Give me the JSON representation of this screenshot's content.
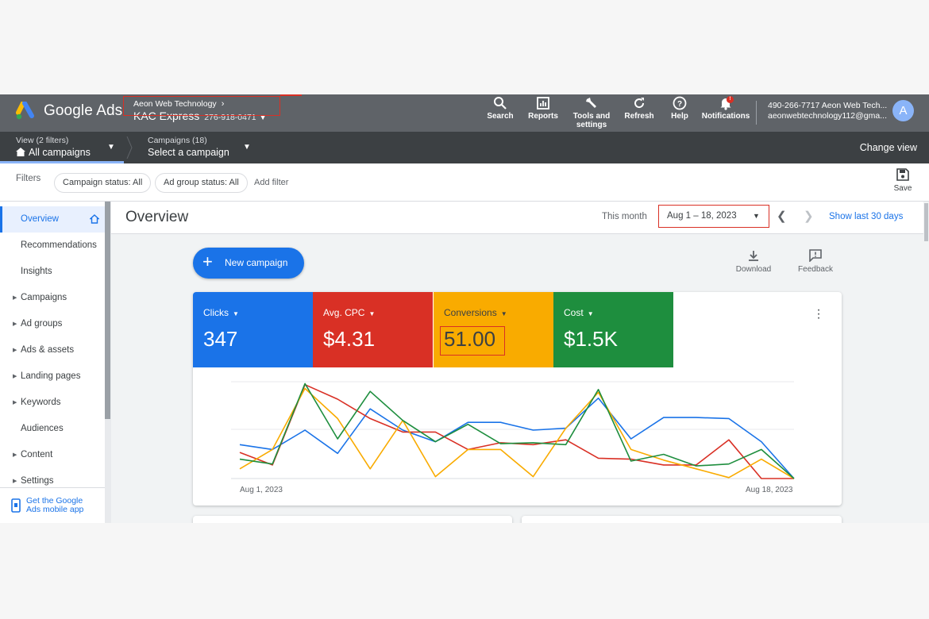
{
  "topbar": {
    "brand": "Google Ads",
    "account_parent": "Aeon Web Technology",
    "account_name": "KAC Express",
    "account_id": "276-918-0471",
    "buttons": [
      {
        "label": "Search",
        "icon": "search-icon"
      },
      {
        "label": "Reports",
        "icon": "reports-icon"
      },
      {
        "label": "Tools and settings",
        "icon": "wrench-icon"
      },
      {
        "label": "Refresh",
        "icon": "refresh-icon"
      },
      {
        "label": "Help",
        "icon": "help-icon"
      },
      {
        "label": "Notifications",
        "icon": "bell-icon",
        "badge": "!"
      }
    ],
    "user_phone": "490-266-7717 Aeon Web Tech...",
    "user_email": "aeonwebtechnology112@gma...",
    "avatar_initial": "A"
  },
  "viewbar": {
    "view_small": "View (2 filters)",
    "view_big": "All campaigns",
    "campaigns_small": "Campaigns (18)",
    "campaigns_big": "Select a campaign",
    "change_view": "Change view"
  },
  "filterbar": {
    "label": "Filters",
    "chips": [
      "Campaign status: All",
      "Ad group status: All"
    ],
    "add_filter": "Add filter",
    "save": "Save"
  },
  "sidebar": {
    "items": [
      {
        "label": "Overview",
        "active": true,
        "expandable": false
      },
      {
        "label": "Recommendations",
        "expandable": false
      },
      {
        "label": "Insights",
        "expandable": false
      },
      {
        "label": "Campaigns",
        "expandable": true
      },
      {
        "label": "Ad groups",
        "expandable": true
      },
      {
        "label": "Ads & assets",
        "expandable": true
      },
      {
        "label": "Landing pages",
        "expandable": true
      },
      {
        "label": "Keywords",
        "expandable": true
      },
      {
        "label": "Audiences",
        "expandable": false
      },
      {
        "label": "Content",
        "expandable": true
      },
      {
        "label": "Settings",
        "expandable": true
      }
    ],
    "app_promo_line1": "Get the Google",
    "app_promo_line2": "Ads mobile app"
  },
  "main": {
    "title": "Overview",
    "this_month": "This month",
    "date_range": "Aug 1 – 18, 2023",
    "show_last": "Show last 30 days",
    "new_campaign": "New campaign",
    "download": "Download",
    "feedback": "Feedback"
  },
  "metrics": [
    {
      "name": "Clicks",
      "value": "347",
      "color": "#1a73e8"
    },
    {
      "name": "Avg. CPC",
      "value": "$4.31",
      "color": "#d93025"
    },
    {
      "name": "Conversions",
      "value": "51.00",
      "color": "#f9ab00"
    },
    {
      "name": "Cost",
      "value": "$1.5K",
      "color": "#1e8e3e"
    }
  ],
  "chart_data": {
    "type": "line",
    "x_start_label": "Aug 1, 2023",
    "x_end_label": "Aug 18, 2023",
    "grid": true,
    "note": "normalized 0-1 scale relative to each series",
    "series": [
      {
        "name": "Clicks",
        "color": "#1a73e8",
        "values": [
          0.35,
          0.3,
          0.5,
          0.26,
          0.72,
          0.5,
          0.38,
          0.58,
          0.58,
          0.5,
          0.52,
          0.83,
          0.41,
          0.63,
          0.63,
          0.62,
          0.38,
          0.0
        ]
      },
      {
        "name": "Avg. CPC",
        "color": "#d93025",
        "values": [
          0.27,
          0.14,
          0.97,
          0.82,
          0.62,
          0.48,
          0.48,
          0.3,
          0.37,
          0.35,
          0.4,
          0.21,
          0.2,
          0.14,
          0.14,
          0.4,
          0.0,
          0.0
        ]
      },
      {
        "name": "Conversions",
        "color": "#f9ab00",
        "values": [
          0.1,
          0.3,
          0.93,
          0.62,
          0.1,
          0.6,
          0.02,
          0.3,
          0.3,
          0.02,
          0.52,
          0.89,
          0.3,
          0.19,
          0.1,
          0.01,
          0.2,
          0.0
        ]
      },
      {
        "name": "Cost",
        "color": "#1e8e3e",
        "values": [
          0.2,
          0.15,
          0.98,
          0.41,
          0.9,
          0.6,
          0.38,
          0.56,
          0.36,
          0.37,
          0.35,
          0.92,
          0.18,
          0.25,
          0.13,
          0.15,
          0.3,
          0.0
        ]
      }
    ]
  }
}
